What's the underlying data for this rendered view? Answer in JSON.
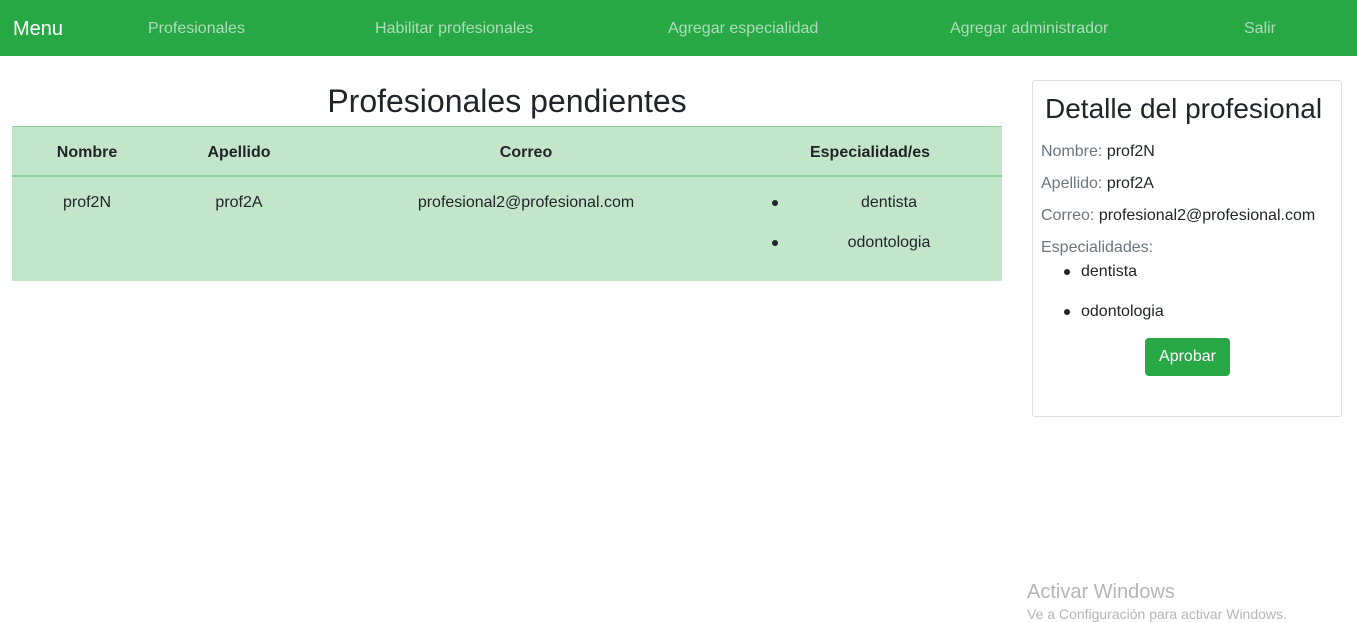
{
  "navbar": {
    "brand": "Menu",
    "links": [
      "Profesionales",
      "Habilitar profesionales",
      "Agregar especialidad",
      "Agregar administrador",
      "Salir"
    ]
  },
  "main": {
    "title": "Profesionales pendientes",
    "table": {
      "headers": [
        "Nombre",
        "Apellido",
        "Correo",
        "Especialidad/es"
      ],
      "rows": [
        {
          "nombre": "prof2N",
          "apellido": "prof2A",
          "correo": "profesional2@profesional.com",
          "especialidades": [
            "dentista",
            "odontologia"
          ]
        }
      ]
    }
  },
  "detail": {
    "title": "Detalle del profesional",
    "nombre_label": "Nombre:",
    "nombre": "prof2N",
    "apellido_label": "Apellido:",
    "apellido": "prof2A",
    "correo_label": "Correo:",
    "correo": "profesional2@profesional.com",
    "especialidades_label": "Especialidades:",
    "especialidades": [
      "dentista",
      "odontologia"
    ],
    "approve_label": "Aprobar"
  },
  "watermark": {
    "title": "Activar Windows",
    "subtitle": "Ve a Configuración para activar Windows."
  },
  "colors": {
    "navbar": "#28a745",
    "table_bg": "#c3e6cb",
    "button": "#28a745"
  }
}
